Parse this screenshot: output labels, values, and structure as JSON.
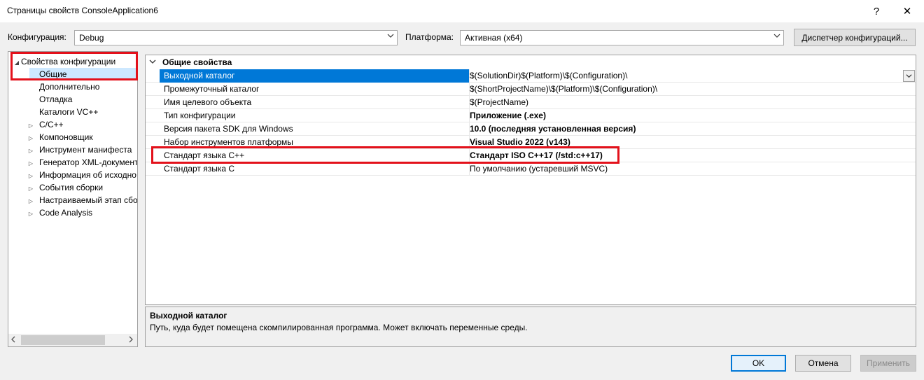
{
  "window": {
    "title": "Страницы свойств ConsoleApplication6",
    "help_glyph": "?",
    "close_glyph": "✕"
  },
  "toolbar": {
    "config_label": "Конфигурация:",
    "config_value": "Debug",
    "platform_label": "Платформа:",
    "platform_value": "Активная (x64)",
    "config_manager_label": "Диспетчер конфигураций..."
  },
  "tree": {
    "root": "Свойства конфигурации",
    "items": [
      {
        "label": "Общие",
        "expandable": false,
        "selected": true
      },
      {
        "label": "Дополнительно",
        "expandable": false
      },
      {
        "label": "Отладка",
        "expandable": false
      },
      {
        "label": "Каталоги VC++",
        "expandable": false
      },
      {
        "label": "C/C++",
        "expandable": true
      },
      {
        "label": "Компоновщик",
        "expandable": true
      },
      {
        "label": "Инструмент манифеста",
        "expandable": true
      },
      {
        "label": "Генератор XML-документ",
        "expandable": true
      },
      {
        "label": "Информация об исходно",
        "expandable": true
      },
      {
        "label": "События сборки",
        "expandable": true
      },
      {
        "label": "Настраиваемый этап сбо",
        "expandable": true
      },
      {
        "label": "Code Analysis",
        "expandable": true
      }
    ]
  },
  "grid": {
    "category": "Общие свойства",
    "rows": [
      {
        "name": "Выходной каталог",
        "value": "$(SolutionDir)$(Platform)\\$(Configuration)\\",
        "bold": false
      },
      {
        "name": "Промежуточный каталог",
        "value": "$(ShortProjectName)\\$(Platform)\\$(Configuration)\\",
        "bold": false
      },
      {
        "name": "Имя целевого объекта",
        "value": "$(ProjectName)",
        "bold": false
      },
      {
        "name": "Тип конфигурации",
        "value": "Приложение (.exe)",
        "bold": true
      },
      {
        "name": "Версия пакета SDK для Windows",
        "value": "10.0 (последняя установленная версия)",
        "bold": true
      },
      {
        "name": "Набор инструментов платформы",
        "value": "Visual Studio 2022 (v143)",
        "bold": true
      },
      {
        "name": "Стандарт языка C++",
        "value": "Стандарт ISO C++17 (/std:c++17)",
        "bold": true
      },
      {
        "name": "Стандарт языка C",
        "value": "По умолчанию (устаревший MSVC)",
        "bold": false
      }
    ]
  },
  "description": {
    "title": "Выходной каталог",
    "text": "Путь, куда будет помещена скомпилированная программа. Может включать переменные среды."
  },
  "buttons": {
    "ok": "OK",
    "cancel": "Отмена",
    "apply": "Применить"
  },
  "colors": {
    "selection": "#0078d7",
    "tree_selection": "#cde8ff",
    "highlight": "#e3111b"
  }
}
